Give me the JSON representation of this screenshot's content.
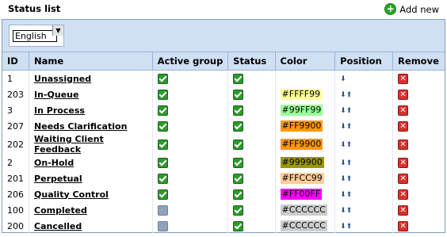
{
  "header": {
    "title": "Status list",
    "add_new_label": "Add new"
  },
  "filter": {
    "language_value": "English"
  },
  "table": {
    "columns": [
      "ID",
      "Name",
      "Active group",
      "Status",
      "Color",
      "Position",
      "Remove"
    ],
    "rows": [
      {
        "id": "1",
        "name": "Unassigned",
        "active_group": true,
        "status": true,
        "color": "",
        "position": "down"
      },
      {
        "id": "203",
        "name": "In-Queue",
        "active_group": true,
        "status": true,
        "color": "#FFFF99",
        "position": "both"
      },
      {
        "id": "3",
        "name": "In Process",
        "active_group": true,
        "status": true,
        "color": "#99FF99",
        "position": "both"
      },
      {
        "id": "207",
        "name": "Needs Clarification",
        "active_group": true,
        "status": true,
        "color": "#FF9900",
        "position": "both"
      },
      {
        "id": "202",
        "name": "Waiting Client Feedback",
        "active_group": true,
        "status": true,
        "color": "#FF9900",
        "position": "both"
      },
      {
        "id": "2",
        "name": "On-Hold",
        "active_group": true,
        "status": true,
        "color": "#999900",
        "position": "both"
      },
      {
        "id": "201",
        "name": "Perpetual",
        "active_group": true,
        "status": true,
        "color": "#FFCC99",
        "position": "both"
      },
      {
        "id": "206",
        "name": "Quality Control",
        "active_group": true,
        "status": true,
        "color": "#FF00FF",
        "position": "both"
      },
      {
        "id": "100",
        "name": "Completed",
        "active_group": false,
        "status": true,
        "color": "#CCCCCC",
        "position": "both"
      },
      {
        "id": "200",
        "name": "Cancelled",
        "active_group": false,
        "status": true,
        "color": "#CCCCCC",
        "position": "both"
      }
    ]
  }
}
